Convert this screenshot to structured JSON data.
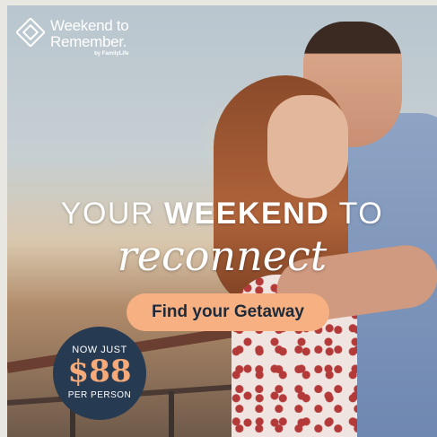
{
  "logo": {
    "line1": "Weekend to",
    "line2": "Remember.",
    "byline": "by FamilyLife",
    "icon": "diamond-logo-icon"
  },
  "headline": {
    "part1": "YOUR ",
    "emphasis": "WEEKEND",
    "part2": " TO",
    "script": "reconnect"
  },
  "cta": {
    "label": "Find your Getaway"
  },
  "price_badge": {
    "prefix": "NOW JUST",
    "amount": "$88",
    "suffix": "PER PERSON"
  },
  "colors": {
    "cta_background": "#f7b081",
    "badge_background": "#263a52",
    "price_accent": "#f6aa79"
  }
}
